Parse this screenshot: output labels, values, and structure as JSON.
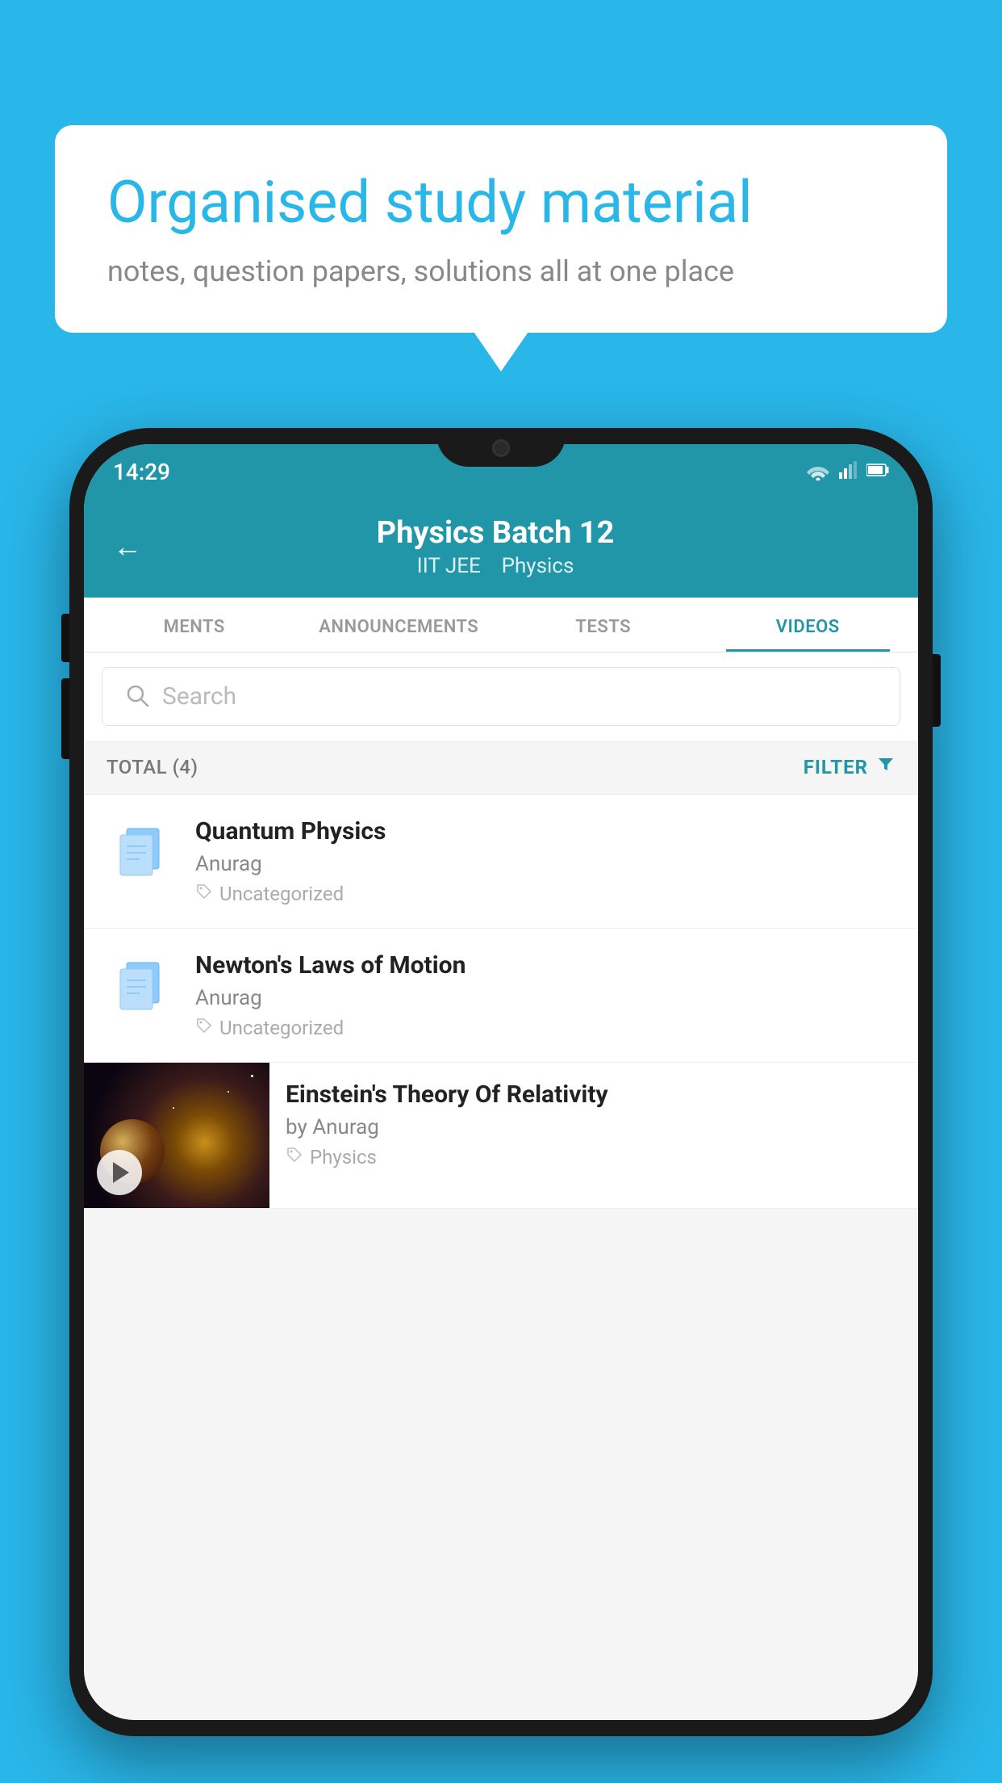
{
  "background_color": "#29b6e8",
  "speech_bubble": {
    "title": "Organised study material",
    "subtitle": "notes, question papers, solutions all at one place"
  },
  "status_bar": {
    "time": "14:29"
  },
  "header": {
    "title": "Physics Batch 12",
    "subtitle_part1": "IIT JEE",
    "subtitle_part2": "Physics",
    "back_label": "←"
  },
  "tabs": [
    {
      "label": "MENTS",
      "active": false
    },
    {
      "label": "ANNOUNCEMENTS",
      "active": false
    },
    {
      "label": "TESTS",
      "active": false
    },
    {
      "label": "VIDEOS",
      "active": true
    }
  ],
  "search": {
    "placeholder": "Search"
  },
  "filter_row": {
    "total_label": "TOTAL (4)",
    "filter_label": "FILTER"
  },
  "videos": [
    {
      "id": "1",
      "title": "Quantum Physics",
      "author": "Anurag",
      "tag": "Uncategorized",
      "has_thumb": false
    },
    {
      "id": "2",
      "title": "Newton's Laws of Motion",
      "author": "Anurag",
      "tag": "Uncategorized",
      "has_thumb": false
    },
    {
      "id": "3",
      "title": "Einstein's Theory Of Relativity",
      "author": "by Anurag",
      "tag": "Physics",
      "has_thumb": true
    }
  ]
}
